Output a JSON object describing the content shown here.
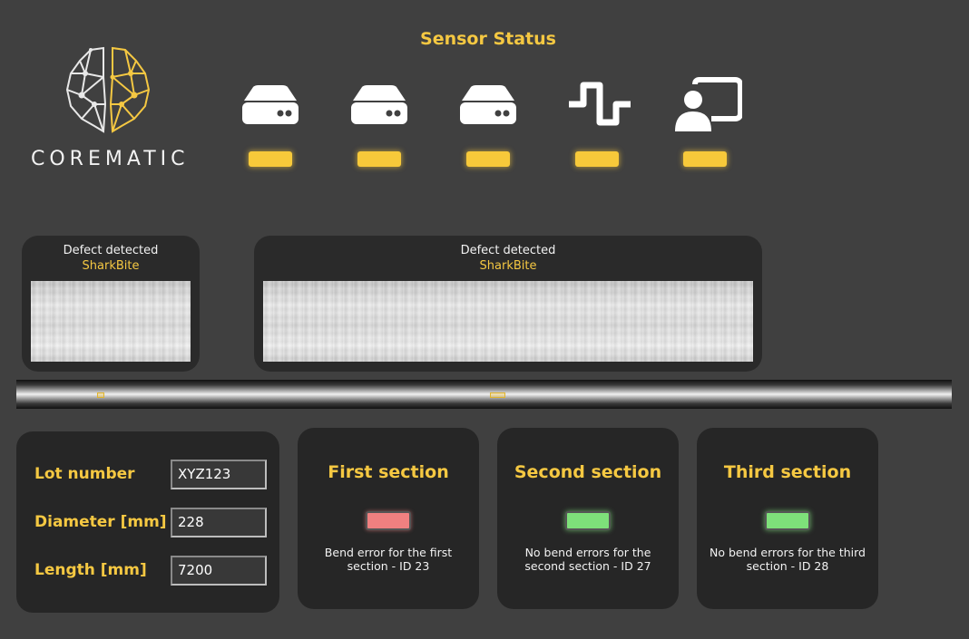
{
  "brand": {
    "name": "COREMATIC"
  },
  "sensor_status": {
    "title": "Sensor Status",
    "sensors": [
      {
        "icon": "server-icon",
        "status_color": "#f7c93a"
      },
      {
        "icon": "server-icon",
        "status_color": "#f7c93a"
      },
      {
        "icon": "server-icon",
        "status_color": "#f7c93a"
      },
      {
        "icon": "signal-wave-icon",
        "status_color": "#f7c93a"
      },
      {
        "icon": "presenter-icon",
        "status_color": "#f7c93a"
      }
    ]
  },
  "defects": [
    {
      "label": "Defect detected",
      "type": "SharkBite"
    },
    {
      "label": "Defect detected",
      "type": "SharkBite"
    }
  ],
  "lot": {
    "lot_number_label": "Lot number",
    "lot_number_value": "XYZ123",
    "diameter_label": "Diameter [mm]",
    "diameter_value": "228",
    "length_label": "Length [mm]",
    "length_value": "7200"
  },
  "sections": [
    {
      "title": "First section",
      "status": "error",
      "status_color": "#f08080",
      "message": "Bend error for the first section - ID 23"
    },
    {
      "title": "Second section",
      "status": "ok",
      "status_color": "#7ee07a",
      "message": "No bend errors for the second section - ID 27"
    },
    {
      "title": "Third section",
      "status": "ok",
      "status_color": "#7ee07a",
      "message": "No bend errors for the third section - ID 28"
    }
  ],
  "colors": {
    "accent": "#f5c842",
    "background": "#404040",
    "panel": "#262626"
  }
}
